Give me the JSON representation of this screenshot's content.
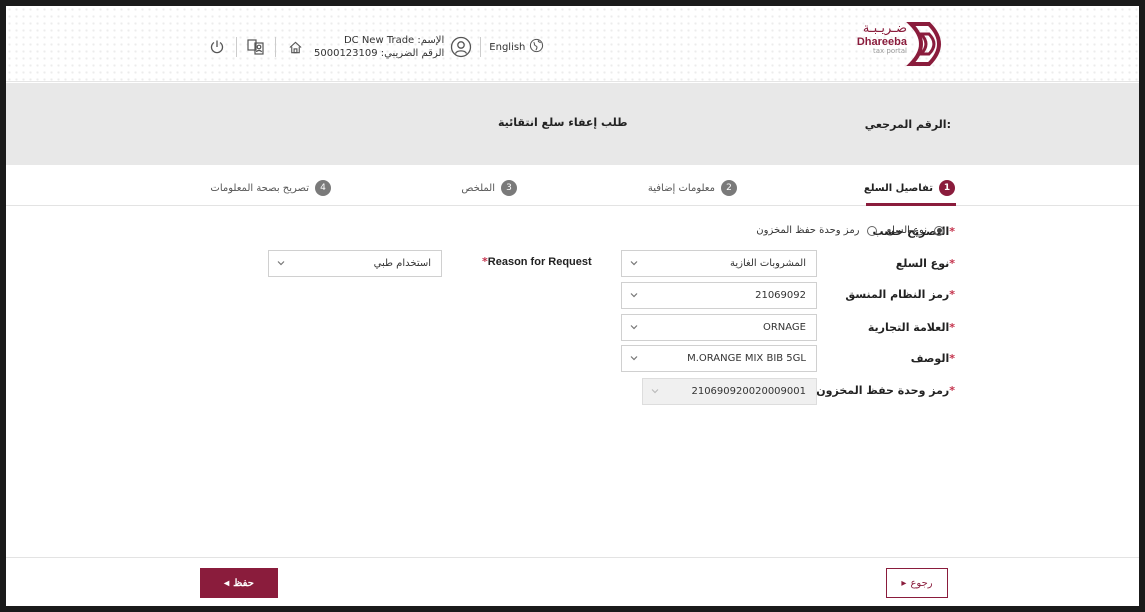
{
  "brand": {
    "name_ar": "ضـريـبـة",
    "name_en": "Dhareeba",
    "tagline": "tax portal",
    "color": "#8a1c3c"
  },
  "header": {
    "language": "English",
    "user_name_line": "الإسم: DC New Trade",
    "tax_number_line": "الرقم الضريبي: 5000123109",
    "icons": [
      "globe-icon",
      "user-icon",
      "home-icon",
      "switch-profile-icon",
      "power-icon"
    ]
  },
  "band": {
    "reference_label": "الرقم المرجعي:",
    "request_title": "طلب إعفاء سلع انتقائية"
  },
  "steps": [
    {
      "number": "1",
      "label": "تفاصيل السلع",
      "active": true
    },
    {
      "number": "2",
      "label": "معلومات إضافية",
      "active": false
    },
    {
      "number": "3",
      "label": "الملخص",
      "active": false
    },
    {
      "number": "4",
      "label": "تصريح بصحة المعلومات",
      "active": false
    }
  ],
  "form": {
    "declare_by": {
      "label": "التصريح حسب",
      "options": [
        "نوع السلع",
        "رمز وحدة حفظ المخزون"
      ],
      "selected": "نوع السلع"
    },
    "goods_type": {
      "label": "نوع السلع",
      "value": "المشروبات الغازية"
    },
    "hs_code": {
      "label": "رمز النظام المنسق",
      "value": "21069092"
    },
    "brand_name": {
      "label": "العلامة التجارية",
      "value": "ORNAGE"
    },
    "description": {
      "label": "الوصف",
      "value": "M.ORANGE MIX BIB 5GL"
    },
    "sku": {
      "label": "رمز وحدة حفظ المخزون",
      "value": "210690920020009001"
    },
    "reason": {
      "label": "Reason for Request",
      "value": "استخدام طبي"
    },
    "required_mark": "*"
  },
  "footer": {
    "save_label": "حفظ",
    "back_label": "رجوع"
  }
}
